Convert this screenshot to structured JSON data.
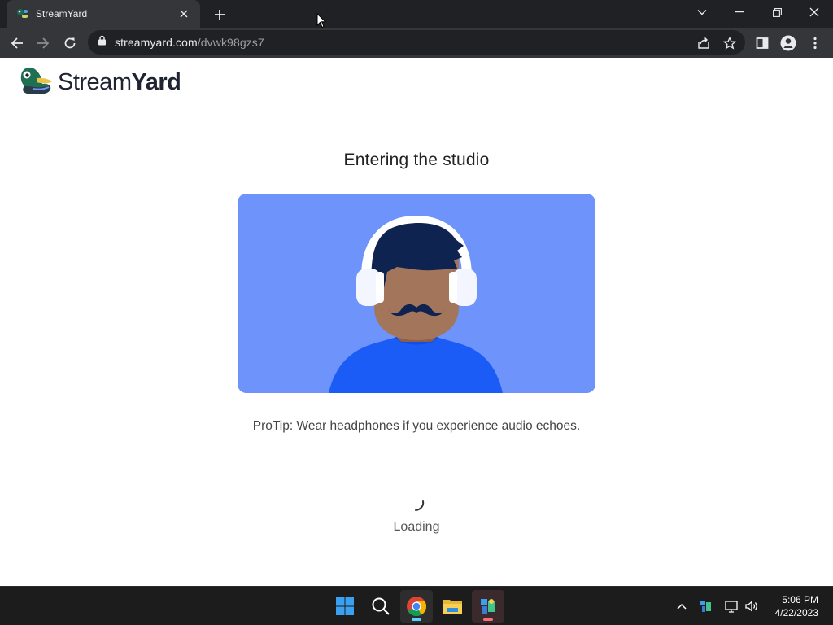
{
  "browser": {
    "tab_title": "StreamYard",
    "url_host": "streamyard.com",
    "url_path": "/dvwk98gzs7"
  },
  "page": {
    "logo_text_regular": "Stream",
    "logo_text_bold": "Yard",
    "heading": "Entering the studio",
    "protip": "ProTip: Wear headphones if you experience audio echoes.",
    "loading": "Loading"
  },
  "colors": {
    "card_background": "#6e93fb",
    "shirt": "#1a5cf5",
    "hair": "#0f2350",
    "skin": "#a3765b"
  },
  "taskbar": {
    "time": "5:06 PM",
    "date": "4/22/2023",
    "items": [
      "start-icon",
      "search-icon",
      "chrome-icon",
      "file-explorer-icon",
      "streamyard-app-icon"
    ]
  }
}
